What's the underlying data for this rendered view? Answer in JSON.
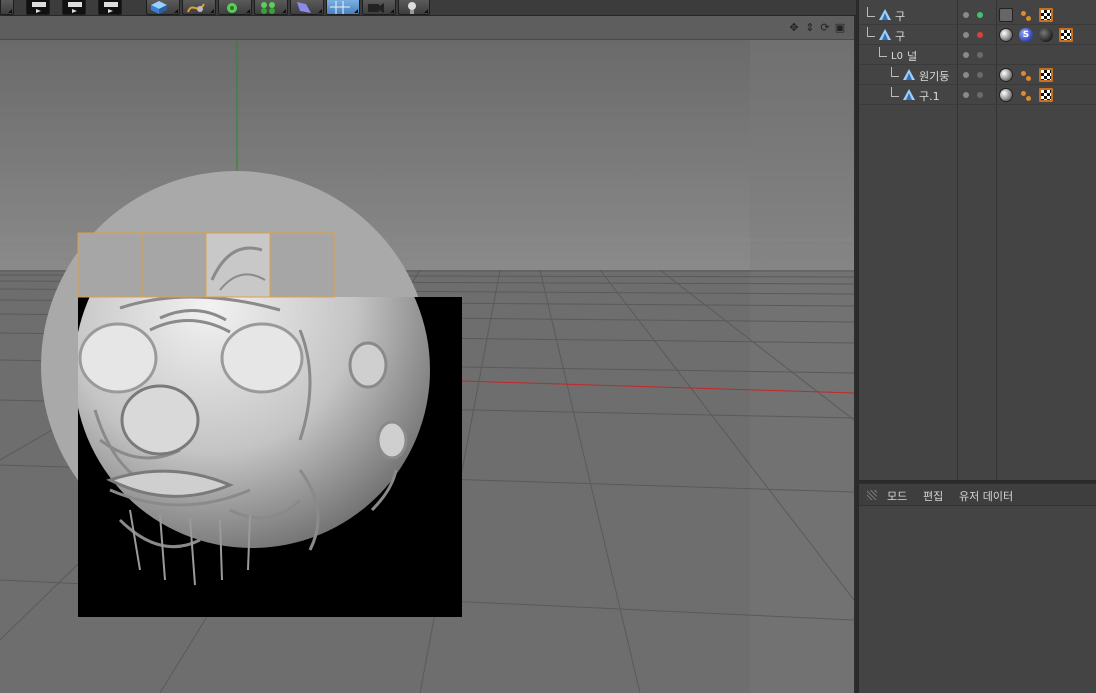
{
  "viewport": {
    "nav_icons": [
      "move-icon",
      "zoom-icon",
      "rotate-icon",
      "layout-icon"
    ]
  },
  "object_manager": {
    "objects": [
      {
        "name": "구",
        "indent": 0,
        "dot_colors": [
          "#8a8a8a",
          "#3ec46d"
        ],
        "tags": [
          "x",
          "phong",
          "check"
        ]
      },
      {
        "name": "구",
        "indent": 0,
        "dot_colors": [
          "#8a8a8a",
          "#d94040"
        ],
        "tags": [
          "sphere",
          "s",
          "dark",
          "check"
        ]
      },
      {
        "name": "널",
        "indent": 1,
        "dot_colors": [
          "#8a8a8a",
          "#6a6a6a"
        ],
        "tags": []
      },
      {
        "name": "원기둥",
        "indent": 2,
        "dot_colors": [
          "#8a8a8a",
          "#6a6a6a"
        ],
        "tags": [
          "sphere",
          "phong",
          "check"
        ]
      },
      {
        "name": "구.1",
        "indent": 2,
        "dot_colors": [
          "#8a8a8a",
          "#6a6a6a"
        ],
        "tags": [
          "sphere",
          "phong",
          "check"
        ]
      }
    ]
  },
  "attribute_manager": {
    "menu": [
      "모드",
      "편집",
      "유저 데이터"
    ]
  },
  "colors": {
    "x_axis": "#c0282a",
    "y_axis": "#2a8a2a",
    "selection": "#e0a040",
    "viewport_bg": "#6c6c6c"
  }
}
